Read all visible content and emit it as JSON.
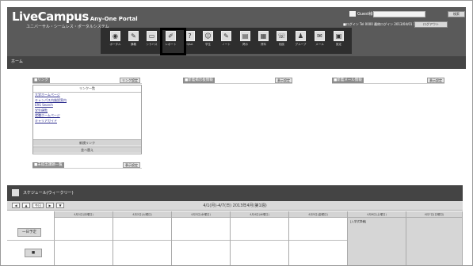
{
  "header": {
    "logo": "LiveCampus",
    "logo_sub": "Any-One Portal",
    "subtitle": "ユニバーサル・シームレス・ポータルシステム",
    "user_label": "Guest様",
    "search_placeholder": "",
    "search_button": "検索",
    "info_line": "■ログイン   Tel 0000   最終ログイン 2013/04/01 10:00",
    "info_button": "ログアウト"
  },
  "icons": [
    {
      "name": "portal-icon",
      "glyph": "◉",
      "caption": "ポータル"
    },
    {
      "name": "course-icon",
      "glyph": "✎",
      "caption": "講義"
    },
    {
      "name": "syllabus-icon",
      "glyph": "▭",
      "caption": "シラバス"
    },
    {
      "name": "report-icon",
      "glyph": "✐",
      "caption": "レポート"
    },
    {
      "name": "qa-icon",
      "glyph": "?",
      "caption": "Q&A"
    },
    {
      "name": "user-icon",
      "glyph": "☺",
      "caption": "学生"
    },
    {
      "name": "note-icon",
      "glyph": "✎",
      "caption": "ノート"
    },
    {
      "name": "board-icon",
      "glyph": "▤",
      "caption": "掲示"
    },
    {
      "name": "document-icon",
      "glyph": "▦",
      "caption": "資料"
    },
    {
      "name": "chat-icon",
      "glyph": "☏",
      "caption": "相談"
    },
    {
      "name": "people-icon",
      "glyph": "♟",
      "caption": "グループ"
    },
    {
      "name": "question-icon",
      "glyph": "✉",
      "caption": "メール"
    },
    {
      "name": "schedule-icon",
      "glyph": "▣",
      "caption": "設定"
    }
  ],
  "nav": {
    "home": "ホーム"
  },
  "widgets": {
    "links": {
      "title": "■リンク",
      "button": "リンク設定",
      "head": "リンク一覧",
      "items": [
        "大学ホームページ",
        "キャンパス内施設案内",
        "ERS Search",
        "学生便覧",
        "就職ホームページ",
        "キャリアガイド"
      ],
      "btn1": "新規リンク",
      "btn2": "並べ替え"
    },
    "notice": {
      "title": "■新着掲示板情報",
      "button": "表示設定"
    },
    "mail": {
      "title": "■新着メール情報",
      "button": "表示設定"
    },
    "submissions": {
      "title": "■未提出課題一覧",
      "button": "表示設定"
    }
  },
  "schedule": {
    "title": "スケジュール(ウィークリー)",
    "nav_buttons": [
      "◀",
      "▲",
      "今日",
      "▶",
      "▼"
    ],
    "week_label": "4/1(月)-4/7(日) 2013年4月(第1週)",
    "days": [
      "4月1日(月曜日)",
      "4月2日(火曜日)",
      "4月3日(水曜日)",
      "4月4日(木曜日)",
      "4月5日(金曜日)",
      "4月6日(土曜日)",
      "4月7日(日曜日)"
    ],
    "row1_label": "一日予定",
    "row2_label": "■",
    "event_text": "[入学式準備]"
  }
}
